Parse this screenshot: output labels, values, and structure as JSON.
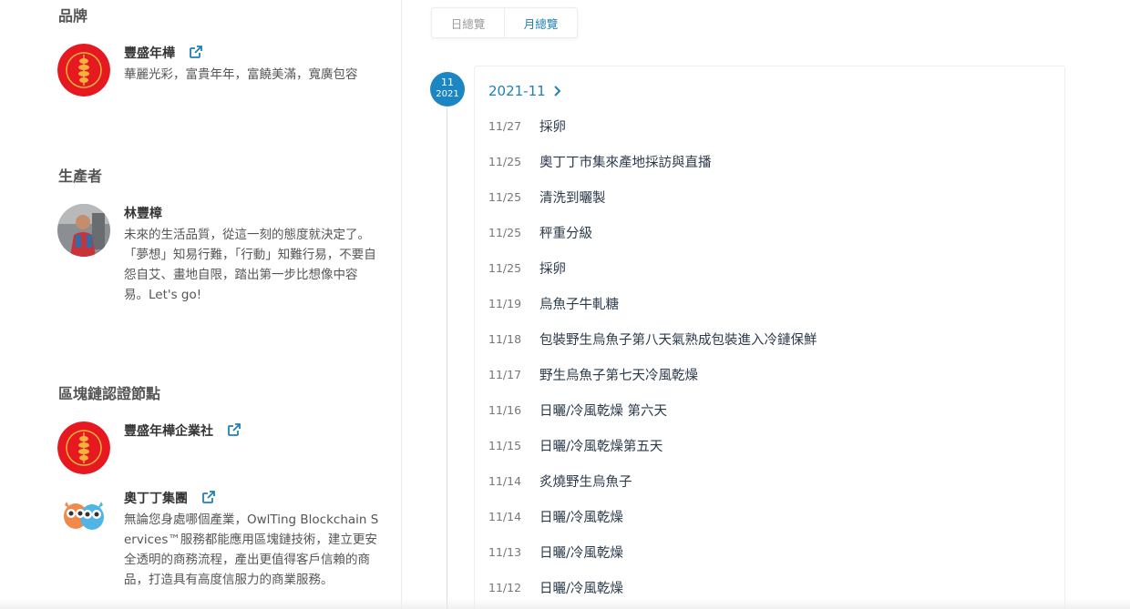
{
  "left": {
    "brand": {
      "title": "品牌",
      "items": [
        {
          "name": "豐盛年樺",
          "desc_lines": [
            "華麗光彩，富貴年年，富饒美滿，寬廣包容"
          ]
        }
      ]
    },
    "producer": {
      "title": "生產者",
      "items": [
        {
          "name": "林豐樟",
          "desc_lines": [
            "未來的生活品質，從這一刻的態度就決定了。",
            "「夢想」知易行難，「行動」知難行易，不要自怨自艾、畫地自限，踏出第一步比想像中容易。Let's go!"
          ]
        }
      ]
    },
    "nodes": {
      "title": "區塊鏈認證節點",
      "items": [
        {
          "name": "豐盛年樺企業社",
          "desc_lines": []
        },
        {
          "name": "奧丁丁集團",
          "desc_lines": [
            "無論您身處哪個產業，OwlTing Blockchain Services™服務都能應用區塊鏈技術，建立更安全透明的商務流程，產出更值得客戶信賴的商品，打造具有高度信服力的商業服務。"
          ]
        }
      ]
    }
  },
  "tabs": {
    "daily": "日總覽",
    "monthly": "月總覽",
    "active": "monthly"
  },
  "timeline": {
    "badge_month": "11",
    "badge_year": "2021",
    "month_label": "2021-11",
    "events": [
      {
        "date": "11/27",
        "title": "採卵"
      },
      {
        "date": "11/25",
        "title": "奧丁丁市集來產地採訪與直播"
      },
      {
        "date": "11/25",
        "title": "清洗到曬製"
      },
      {
        "date": "11/25",
        "title": "秤重分級"
      },
      {
        "date": "11/25",
        "title": "採卵"
      },
      {
        "date": "11/19",
        "title": "烏魚子牛軋糖"
      },
      {
        "date": "11/18",
        "title": "包裝野生烏魚子第八天氣熟成包裝進入冷鏈保鮮"
      },
      {
        "date": "11/17",
        "title": "野生烏魚子第七天冷風乾燥"
      },
      {
        "date": "11/16",
        "title": "日曬/冷風乾燥 第六天"
      },
      {
        "date": "11/15",
        "title": "日曬/冷風乾燥第五天"
      },
      {
        "date": "11/14",
        "title": "炙燒野生烏魚子"
      },
      {
        "date": "11/14",
        "title": "日曬/冷風乾燥"
      },
      {
        "date": "11/13",
        "title": "日曬/冷風乾燥"
      },
      {
        "date": "11/12",
        "title": "日曬/冷風乾燥"
      }
    ]
  },
  "colors": {
    "accent": "#1b86c2",
    "brand_red": "#e5191f"
  }
}
